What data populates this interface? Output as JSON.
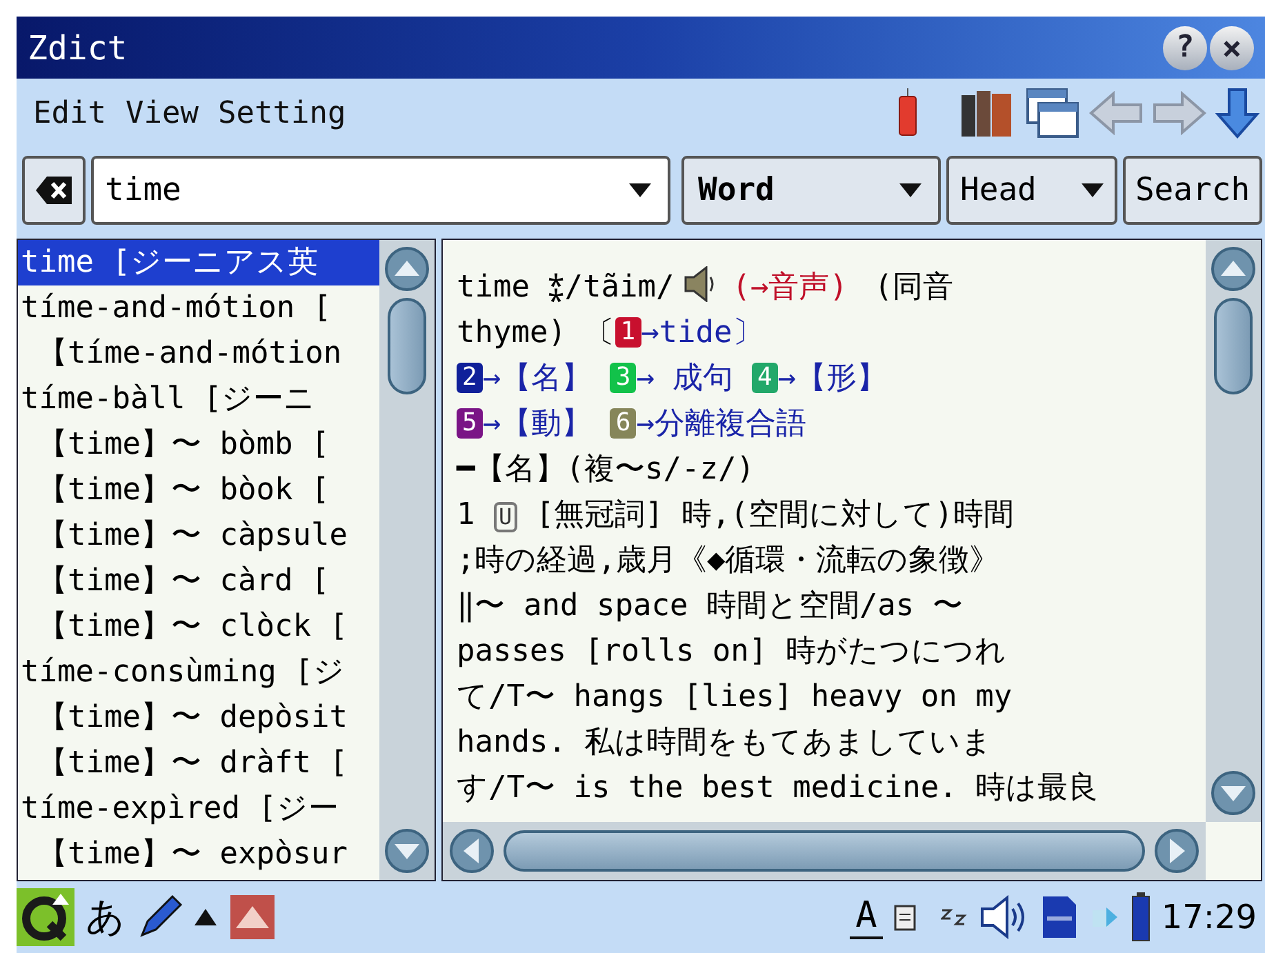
{
  "window": {
    "title": "Zdict",
    "help_button": "?",
    "close_button": "×"
  },
  "menu": [
    "Edit",
    "View",
    "Setting"
  ],
  "search": {
    "value": "time",
    "mode": "Word",
    "scope": "Head",
    "button": "Search"
  },
  "results": [
    {
      "text": "time [ジーニアス英",
      "selected": true
    },
    {
      "text": "tíme-and-mótion [",
      "selected": false,
      "children": [
        {
          "text": "【tíme-and-mótion",
          "selected": false
        }
      ]
    },
    {
      "text": "tíme-bàll [ジーニ",
      "selected": false,
      "children": [
        {
          "text": "【time】〜 bòmb [",
          "selected": false
        },
        {
          "text": "【time】〜 bòok [",
          "selected": false
        },
        {
          "text": "【time】〜 càpsule",
          "selected": false
        },
        {
          "text": "【time】〜 càrd [",
          "selected": false
        },
        {
          "text": "【time】〜 clòck [",
          "selected": false
        }
      ]
    },
    {
      "text": "tíme-consùming [ジ",
      "selected": false,
      "children": [
        {
          "text": "【time】〜 depòsit",
          "selected": false
        },
        {
          "text": "【time】〜 dràft [",
          "selected": false
        }
      ]
    },
    {
      "text": "tíme-expìred [ジー",
      "selected": false,
      "children": [
        {
          "text": "【time】〜 expòsur",
          "selected": false
        }
      ]
    }
  ],
  "entry": {
    "lines": [
      [
        {
          "kind": "text",
          "text": "time ⁑/tãim/"
        },
        {
          "kind": "speaker"
        },
        {
          "kind": "link",
          "text": "(→音声)"
        },
        {
          "kind": "text",
          "text": " (同音"
        }
      ],
      [
        {
          "kind": "text",
          "text": "thyme) 〔"
        },
        {
          "kind": "badge",
          "text": "1",
          "color": "#c8102e"
        },
        {
          "kind": "ref",
          "text": "→tide〕"
        }
      ],
      [
        {
          "kind": "badge",
          "text": "2",
          "color": "#10209a"
        },
        {
          "kind": "ref",
          "text": "→【名】 "
        },
        {
          "kind": "badge",
          "text": "3",
          "color": "#12c24a"
        },
        {
          "kind": "ref",
          "text": "→ 成句 "
        },
        {
          "kind": "badge",
          "text": "4",
          "color": "#22a86a"
        },
        {
          "kind": "ref",
          "text": "→【形】"
        }
      ],
      [
        {
          "kind": "badge",
          "text": "5",
          "color": "#7a1486"
        },
        {
          "kind": "ref",
          "text": "→【動】 "
        },
        {
          "kind": "badge",
          "text": "6",
          "color": "#86865a"
        },
        {
          "kind": "ref",
          "text": "→分離複合語"
        }
      ],
      [
        {
          "kind": "text",
          "text": "━【名】(複〜s/-z/)"
        }
      ],
      [
        {
          "kind": "text",
          "text": "1 "
        },
        {
          "kind": "boxed",
          "text": "U"
        },
        {
          "kind": "text",
          "text": " [無冠詞] 時,(空間に対して)時間"
        }
      ],
      [
        {
          "kind": "text",
          "text": " ;時の経過,歳月《◆循環・流転の象徴》"
        }
      ],
      [
        {
          "kind": "text",
          "text": " ‖〜 and space 時間と空間/as 〜"
        }
      ],
      [
        {
          "kind": "text",
          "text": "passes [rolls on] 時がたつにつれ"
        }
      ],
      [
        {
          "kind": "text",
          "text": "て/T〜 hangs [lies] heavy on my"
        }
      ],
      [
        {
          "kind": "text",
          "text": "hands. 私は時間をもてあましていま"
        }
      ],
      [
        {
          "kind": "text",
          "text": "す/T〜 is the best medicine. 時は最良"
        }
      ]
    ]
  },
  "taskbar": {
    "ime": "あ",
    "input_mode": "A",
    "clock": "17:29"
  }
}
